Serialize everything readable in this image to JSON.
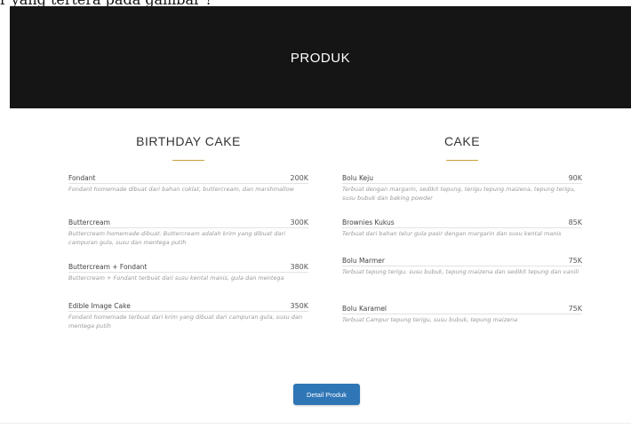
{
  "caption": "r yang tertera pada gambar ?",
  "hero": {
    "title": "PRODUK"
  },
  "columns": [
    {
      "title": "BIRTHDAY CAKE",
      "items": [
        {
          "name": "Fondant",
          "price": "200K",
          "desc": "Fondant homemade dibuat dari bahan coklat, buttercream, dan marshmallow"
        },
        {
          "name": "Buttercream",
          "price": "300K",
          "desc": "Buttercream homemade dibuat. Buttercream adalah krim yang dibuat dari campuran gula, susu dan mentega putih"
        },
        {
          "name": "Buttercream + Fondant",
          "price": "380K",
          "desc": "Buttercream + Fondant terbuat dari susu kental manis, gula dan mentega"
        },
        {
          "name": "Edible Image Cake",
          "price": "350K",
          "desc": "Fondant homemade terbuat dari krim yang dibuat dari campuran gula, susu dan mentega putih"
        }
      ]
    },
    {
      "title": "CAKE",
      "items": [
        {
          "name": "Bolu Keju",
          "price": "90K",
          "desc": "Terbuat dengan margarin, sedikit tepung, terigu tepung maizena, tepung terigu, susu bubuk dan baking powder"
        },
        {
          "name": "Brownies Kukus",
          "price": "85K",
          "desc": "Terbuat dari bahan telur gula pasir dengan margarin dan susu kental manis"
        },
        {
          "name": "Bolu Marmer",
          "price": "75K",
          "desc": "Terbuat tepung terigu, susu bubuk, tepung maizena dan sedikit tepung dan vanili"
        },
        {
          "name": "Bolu Karamel",
          "price": "75K",
          "desc": "Terbuat Campur tepung terigu, susu bubuk, tepung maizena"
        }
      ]
    }
  ],
  "button": {
    "label": "Detail Produk"
  },
  "colors": {
    "hero_bg": "#151515",
    "accent": "#c9a23a",
    "button_bg": "#2f76b6"
  }
}
